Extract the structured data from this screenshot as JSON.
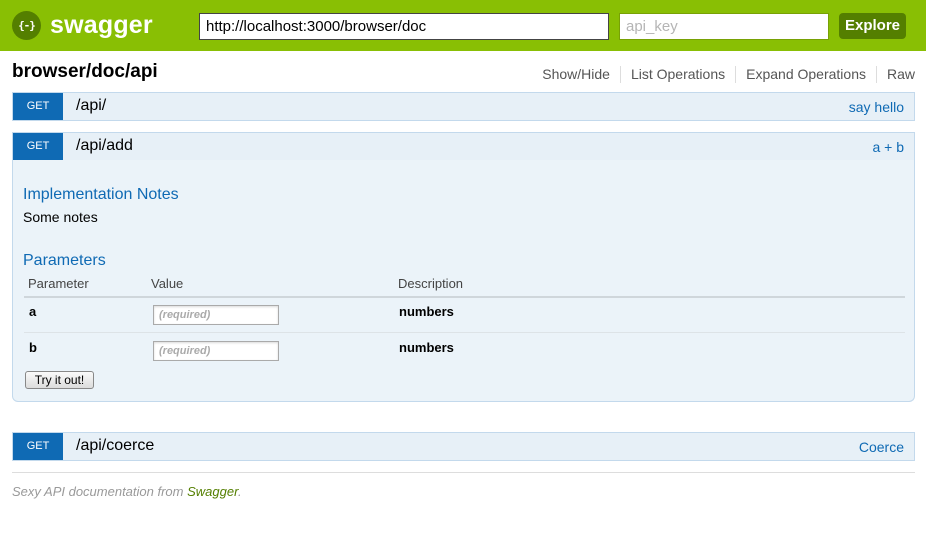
{
  "header": {
    "logo_icon": "{-}",
    "logo_text": "swagger",
    "url_value": "http://localhost:3000/browser/doc",
    "api_key_placeholder": "api_key",
    "explore_label": "Explore"
  },
  "resource": {
    "title": "browser/doc/api",
    "links": {
      "show_hide": "Show/Hide",
      "list_operations": "List Operations",
      "expand_operations": "Expand Operations",
      "raw": "Raw"
    }
  },
  "operations": [
    {
      "method": "GET",
      "path": "/api/",
      "summary": "say hello"
    },
    {
      "method": "GET",
      "path": "/api/add",
      "summary": "a + b"
    },
    {
      "method": "GET",
      "path": "/api/coerce",
      "summary": "Coerce"
    }
  ],
  "expanded": {
    "impl_title": "Implementation Notes",
    "notes": "Some notes",
    "params_title": "Parameters",
    "columns": {
      "parameter": "Parameter",
      "value": "Value",
      "description": "Description"
    },
    "params": [
      {
        "name": "a",
        "placeholder": "(required)",
        "description": "numbers"
      },
      {
        "name": "b",
        "placeholder": "(required)",
        "description": "numbers"
      }
    ],
    "try_label": "Try it out!"
  },
  "footer": {
    "text_before": "Sexy API documentation from ",
    "link": "Swagger",
    "text_after": "."
  },
  "colors": {
    "header_bg": "#89bf04",
    "accent_dark_green": "#547f00",
    "method_get": "#0f6ab4",
    "op_bg": "#e7f0f7"
  }
}
